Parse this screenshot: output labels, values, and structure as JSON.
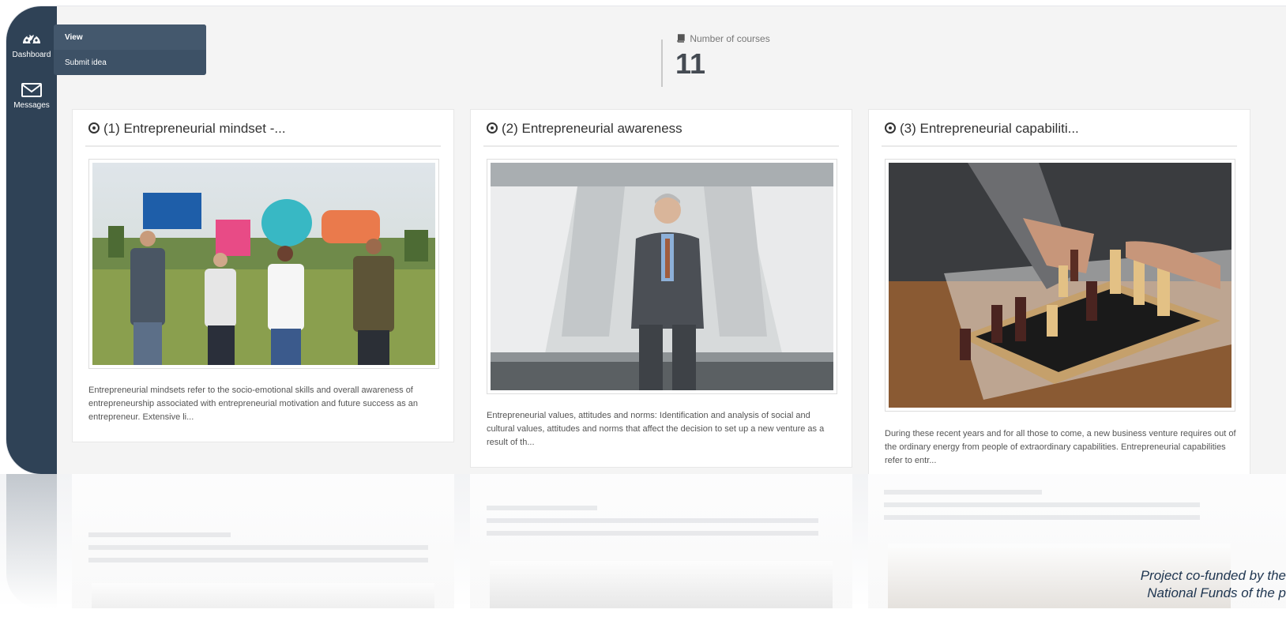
{
  "sidebar": {
    "items": [
      {
        "label": "Dashboard",
        "icon": "dashboard-gauge-icon"
      },
      {
        "label": "Messages",
        "icon": "envelope-icon"
      }
    ]
  },
  "dropdown": {
    "items": [
      {
        "label": "View"
      },
      {
        "label": "Submit idea"
      }
    ]
  },
  "stats": {
    "label": "Number of courses",
    "icon": "book-icon",
    "value": "11"
  },
  "courses": [
    {
      "title": "(1) Entrepreneurial mindset -...",
      "image": "people-holding-speech-bubbles-photo",
      "description": "Entrepreneurial mindsets refer to the socio-emotional skills and overall awareness of entrepreneurship associated with entrepreneurial motivation and future success as an entrepreneur. Extensive li..."
    },
    {
      "title": "(2) Entrepreneurial awareness",
      "image": "businessman-standing-photo",
      "description": "Entrepreneurial values, attitudes and norms: Identification and analysis of social and cultural values, attitudes and norms that affect the decision to set up a new venture as a result of th..."
    },
    {
      "title": "(3) Entrepreneurial capabiliti...",
      "image": "hand-moving-chess-piece-photo",
      "description": "During these recent years and for all those to come, a new business venture requires out of the ordinary energy from people of extraordinary capabilities. Entrepreneurial capabilities refer to entr..."
    }
  ],
  "footer": {
    "line1": "Project co-funded by the",
    "line2": "National Funds of the p"
  },
  "colors": {
    "sidebar": "#2f4256",
    "dropdown": "#3d5166",
    "background": "#f4f4f4",
    "text": "#333333"
  }
}
